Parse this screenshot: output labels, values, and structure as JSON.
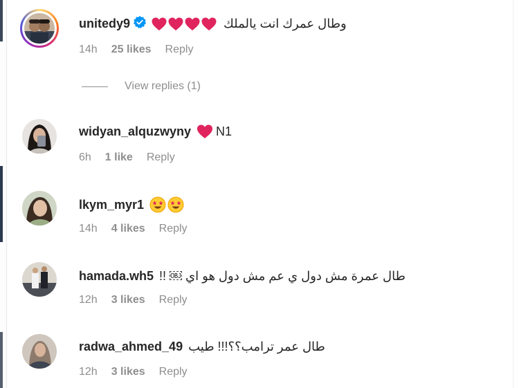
{
  "comments": [
    {
      "username": "unitedy9",
      "verified": true,
      "text": "وطال عمرك انت يالملك",
      "hearts": 4,
      "time": "14h",
      "likes": "25 likes",
      "reply": "Reply"
    },
    {
      "username": "widyan_alquzwyny",
      "text": "N1",
      "time": "6h",
      "likes": "1 like",
      "reply": "Reply"
    },
    {
      "username": "lkym_myr1",
      "text": "",
      "time": "14h",
      "likes": "4 likes",
      "reply": "Reply"
    },
    {
      "username": "hamada.wh5",
      "text": "طال عمرة مش دول ي عم مش دول هو اي ￼ !!",
      "time": "12h",
      "likes": "3 likes",
      "reply": "Reply"
    },
    {
      "username": "radwa_ahmed_49",
      "text": "طال عمر ترامب؟؟!!! طيب",
      "time": "12h",
      "likes": "3 likes",
      "reply": "Reply"
    }
  ],
  "view_replies": {
    "label": "View replies (1)"
  },
  "icons": {
    "verified": "verified-badge-icon",
    "heart": "red-heart-emoji",
    "star_eyes": "star-struck-emoji"
  },
  "colors": {
    "text": "#262626",
    "meta": "#8e8e8e",
    "verified": "#0095f6",
    "heart": "#e0245e"
  }
}
